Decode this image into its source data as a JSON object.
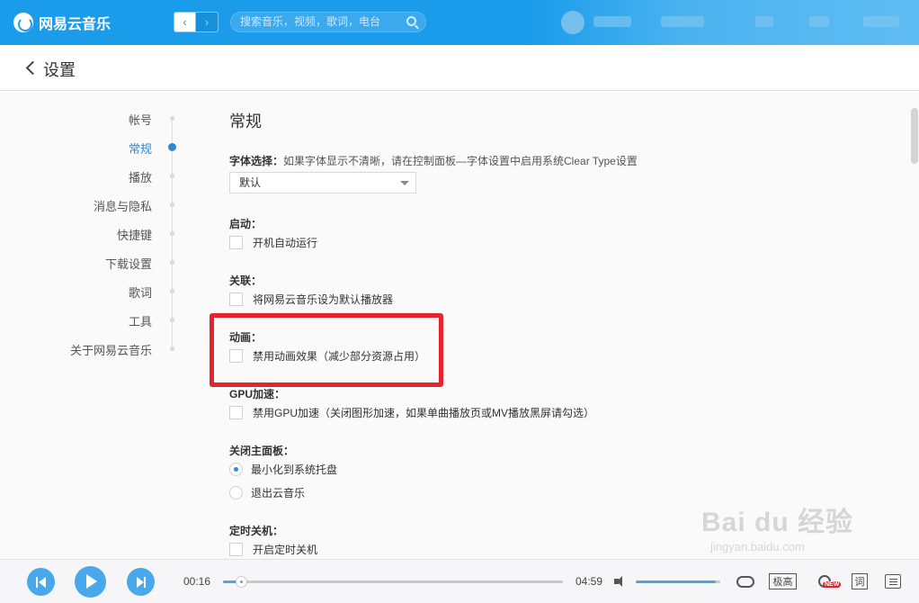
{
  "app": {
    "name": "网易云音乐"
  },
  "topbar": {
    "search_placeholder": "搜索音乐，视频，歌词，电台",
    "back_arrow": "‹",
    "forward_arrow": "›"
  },
  "header": {
    "back_icon": "chevron-left-icon",
    "title": "设置"
  },
  "sidenav": {
    "items": [
      {
        "label": "帐号",
        "active": false
      },
      {
        "label": "常规",
        "active": true
      },
      {
        "label": "播放",
        "active": false
      },
      {
        "label": "消息与隐私",
        "active": false
      },
      {
        "label": "快捷键",
        "active": false
      },
      {
        "label": "下载设置",
        "active": false
      },
      {
        "label": "歌词",
        "active": false
      },
      {
        "label": "工具",
        "active": false
      },
      {
        "label": "关于网易云音乐",
        "active": false
      }
    ]
  },
  "content": {
    "section_title": "常规",
    "font": {
      "label": "字体选择：",
      "hint": "如果字体显示不清晰，请在控制面板—字体设置中启用系统Clear Type设置",
      "selected": "默认"
    },
    "startup": {
      "label": "启动：",
      "option": "开机自动运行",
      "checked": false
    },
    "association": {
      "label": "关联：",
      "option": "将网易云音乐设为默认播放器",
      "checked": false
    },
    "animation": {
      "label": "动画：",
      "option": "禁用动画效果（减少部分资源占用）",
      "checked": false
    },
    "gpu": {
      "label": "GPU加速：",
      "option": "禁用GPU加速（关闭图形加速，如果单曲播放页或MV播放黑屏请勾选）",
      "checked": false
    },
    "close_panel": {
      "label": "关闭主面板：",
      "options": [
        {
          "label": "最小化到系统托盘",
          "checked": true
        },
        {
          "label": "退出云音乐",
          "checked": false
        }
      ]
    },
    "timer": {
      "label": "定时关机：",
      "option": "开启定时关机",
      "checked": false
    }
  },
  "player": {
    "current_time": "00:16",
    "total_time": "04:59",
    "progress_fraction": 0.053,
    "volume_fraction": 0.95,
    "quality_label": "极高",
    "fx_badge": "NEW",
    "lyric_label": "词"
  },
  "watermark": {
    "main": "Bai du 经验",
    "sub": "jingyan.baidu.com"
  },
  "colors": {
    "accent": "#1b9cea",
    "highlight": "#e5232c",
    "active_nav": "#2d8ad6"
  }
}
